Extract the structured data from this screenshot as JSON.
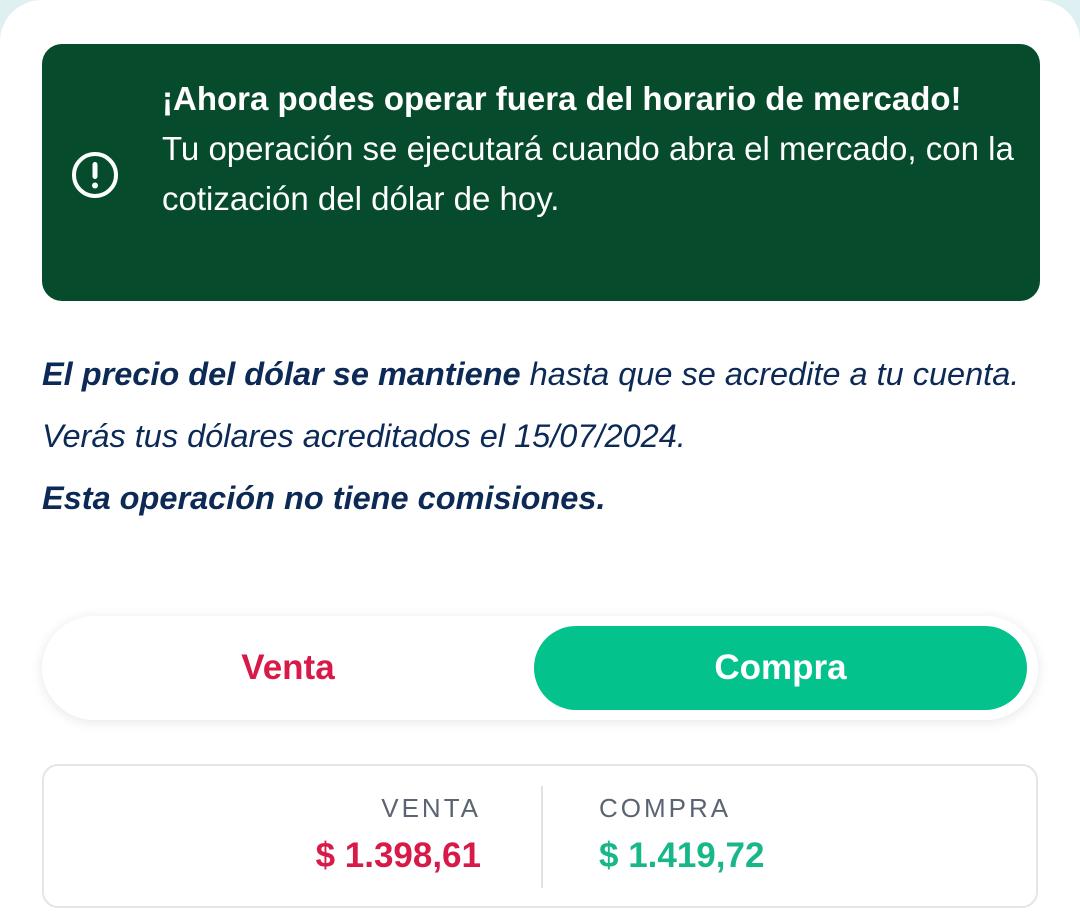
{
  "banner": {
    "title": "¡Ahora podes operar fuera del horario de mercado!",
    "body": "Tu operación se ejecutará cuando abra el mercado, con la cotización del dólar de hoy.",
    "icon": "exclamation-circle-icon",
    "background_color": "#064b2b"
  },
  "info": {
    "line1_strong": "El precio del dólar se mantiene",
    "line1_rest": " hasta que se acredite a tu cuenta.",
    "line2": "Verás tus dólares acreditados el 15/07/2024.",
    "line3": "Esta operación no tiene comisiones."
  },
  "toggle": {
    "venta_label": "Venta",
    "compra_label": "Compra",
    "selected": "Compra",
    "venta_color": "#d81a49",
    "compra_color": "#03c28b"
  },
  "quote": {
    "venta_label": "VENTA",
    "venta_value": "$ 1.398,61",
    "compra_label": "COMPRA",
    "compra_value": "$ 1.419,72"
  }
}
